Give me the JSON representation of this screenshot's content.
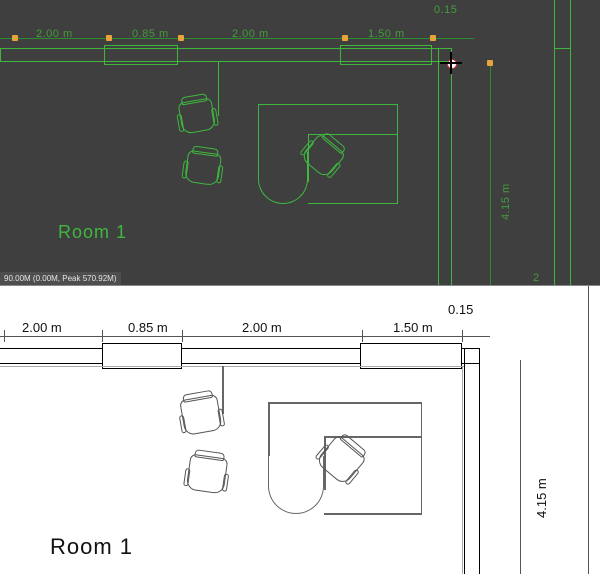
{
  "colors": {
    "bim_bg": "#3f3f3f",
    "bim_line": "#3fb73f",
    "render_line": "#555"
  },
  "status_bar": {
    "text": "90.00M (0.00M, Peak 570.92M)"
  },
  "room_label": "Room 1",
  "dimensions": {
    "top": [
      {
        "label": "2.00 m"
      },
      {
        "label": "0.85 m"
      },
      {
        "label": "2.00 m"
      },
      {
        "label": "1.50 m"
      }
    ],
    "top_right_small": "0.15",
    "right_vertical": "4.15 m",
    "right_vertical_cut": "2"
  },
  "furniture": {
    "chairs": [
      {
        "name": "chair-left-top",
        "rotation": -10
      },
      {
        "name": "chair-left-bottom",
        "rotation": 8
      },
      {
        "name": "chair-desk",
        "rotation": 40
      }
    ],
    "desk": {
      "name": "l-desk"
    }
  }
}
